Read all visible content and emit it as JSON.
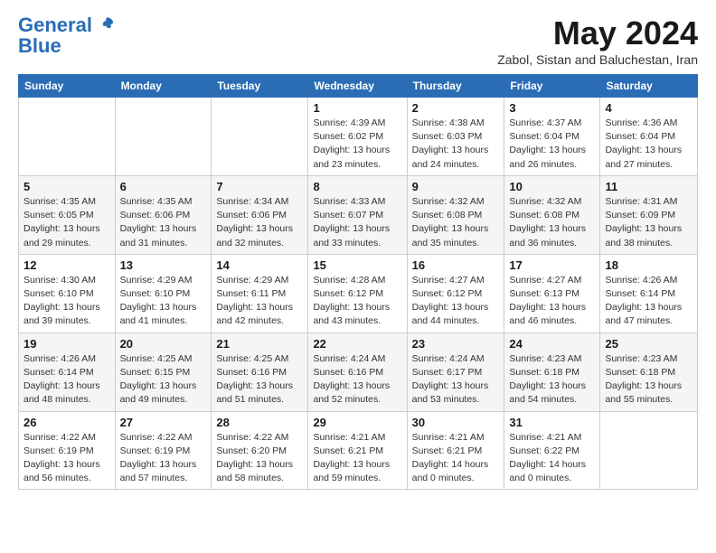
{
  "logo": {
    "line1": "General",
    "line2": "Blue"
  },
  "title": "May 2024",
  "subtitle": "Zabol, Sistan and Baluchestan, Iran",
  "headers": [
    "Sunday",
    "Monday",
    "Tuesday",
    "Wednesday",
    "Thursday",
    "Friday",
    "Saturday"
  ],
  "weeks": [
    [
      {
        "day": "",
        "info": ""
      },
      {
        "day": "",
        "info": ""
      },
      {
        "day": "",
        "info": ""
      },
      {
        "day": "1",
        "info": "Sunrise: 4:39 AM\nSunset: 6:02 PM\nDaylight: 13 hours\nand 23 minutes."
      },
      {
        "day": "2",
        "info": "Sunrise: 4:38 AM\nSunset: 6:03 PM\nDaylight: 13 hours\nand 24 minutes."
      },
      {
        "day": "3",
        "info": "Sunrise: 4:37 AM\nSunset: 6:04 PM\nDaylight: 13 hours\nand 26 minutes."
      },
      {
        "day": "4",
        "info": "Sunrise: 4:36 AM\nSunset: 6:04 PM\nDaylight: 13 hours\nand 27 minutes."
      }
    ],
    [
      {
        "day": "5",
        "info": "Sunrise: 4:35 AM\nSunset: 6:05 PM\nDaylight: 13 hours\nand 29 minutes."
      },
      {
        "day": "6",
        "info": "Sunrise: 4:35 AM\nSunset: 6:06 PM\nDaylight: 13 hours\nand 31 minutes."
      },
      {
        "day": "7",
        "info": "Sunrise: 4:34 AM\nSunset: 6:06 PM\nDaylight: 13 hours\nand 32 minutes."
      },
      {
        "day": "8",
        "info": "Sunrise: 4:33 AM\nSunset: 6:07 PM\nDaylight: 13 hours\nand 33 minutes."
      },
      {
        "day": "9",
        "info": "Sunrise: 4:32 AM\nSunset: 6:08 PM\nDaylight: 13 hours\nand 35 minutes."
      },
      {
        "day": "10",
        "info": "Sunrise: 4:32 AM\nSunset: 6:08 PM\nDaylight: 13 hours\nand 36 minutes."
      },
      {
        "day": "11",
        "info": "Sunrise: 4:31 AM\nSunset: 6:09 PM\nDaylight: 13 hours\nand 38 minutes."
      }
    ],
    [
      {
        "day": "12",
        "info": "Sunrise: 4:30 AM\nSunset: 6:10 PM\nDaylight: 13 hours\nand 39 minutes."
      },
      {
        "day": "13",
        "info": "Sunrise: 4:29 AM\nSunset: 6:10 PM\nDaylight: 13 hours\nand 41 minutes."
      },
      {
        "day": "14",
        "info": "Sunrise: 4:29 AM\nSunset: 6:11 PM\nDaylight: 13 hours\nand 42 minutes."
      },
      {
        "day": "15",
        "info": "Sunrise: 4:28 AM\nSunset: 6:12 PM\nDaylight: 13 hours\nand 43 minutes."
      },
      {
        "day": "16",
        "info": "Sunrise: 4:27 AM\nSunset: 6:12 PM\nDaylight: 13 hours\nand 44 minutes."
      },
      {
        "day": "17",
        "info": "Sunrise: 4:27 AM\nSunset: 6:13 PM\nDaylight: 13 hours\nand 46 minutes."
      },
      {
        "day": "18",
        "info": "Sunrise: 4:26 AM\nSunset: 6:14 PM\nDaylight: 13 hours\nand 47 minutes."
      }
    ],
    [
      {
        "day": "19",
        "info": "Sunrise: 4:26 AM\nSunset: 6:14 PM\nDaylight: 13 hours\nand 48 minutes."
      },
      {
        "day": "20",
        "info": "Sunrise: 4:25 AM\nSunset: 6:15 PM\nDaylight: 13 hours\nand 49 minutes."
      },
      {
        "day": "21",
        "info": "Sunrise: 4:25 AM\nSunset: 6:16 PM\nDaylight: 13 hours\nand 51 minutes."
      },
      {
        "day": "22",
        "info": "Sunrise: 4:24 AM\nSunset: 6:16 PM\nDaylight: 13 hours\nand 52 minutes."
      },
      {
        "day": "23",
        "info": "Sunrise: 4:24 AM\nSunset: 6:17 PM\nDaylight: 13 hours\nand 53 minutes."
      },
      {
        "day": "24",
        "info": "Sunrise: 4:23 AM\nSunset: 6:18 PM\nDaylight: 13 hours\nand 54 minutes."
      },
      {
        "day": "25",
        "info": "Sunrise: 4:23 AM\nSunset: 6:18 PM\nDaylight: 13 hours\nand 55 minutes."
      }
    ],
    [
      {
        "day": "26",
        "info": "Sunrise: 4:22 AM\nSunset: 6:19 PM\nDaylight: 13 hours\nand 56 minutes."
      },
      {
        "day": "27",
        "info": "Sunrise: 4:22 AM\nSunset: 6:19 PM\nDaylight: 13 hours\nand 57 minutes."
      },
      {
        "day": "28",
        "info": "Sunrise: 4:22 AM\nSunset: 6:20 PM\nDaylight: 13 hours\nand 58 minutes."
      },
      {
        "day": "29",
        "info": "Sunrise: 4:21 AM\nSunset: 6:21 PM\nDaylight: 13 hours\nand 59 minutes."
      },
      {
        "day": "30",
        "info": "Sunrise: 4:21 AM\nSunset: 6:21 PM\nDaylight: 14 hours\nand 0 minutes."
      },
      {
        "day": "31",
        "info": "Sunrise: 4:21 AM\nSunset: 6:22 PM\nDaylight: 14 hours\nand 0 minutes."
      },
      {
        "day": "",
        "info": ""
      }
    ]
  ]
}
